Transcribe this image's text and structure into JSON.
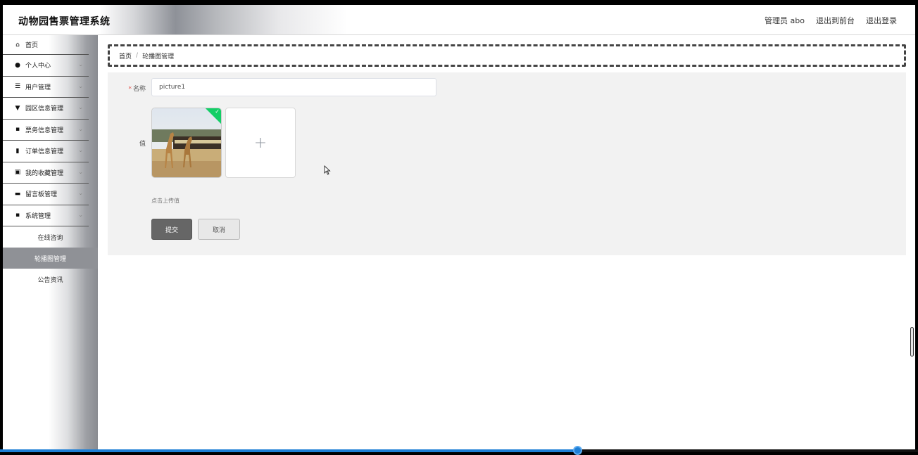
{
  "header": {
    "title": "动物园售票管理系统",
    "links": [
      "管理员 abo",
      "退出到前台",
      "退出登录"
    ]
  },
  "sidebar": {
    "items": [
      {
        "icon": "home-icon",
        "glyph": "⌂",
        "label": "首页",
        "has_children": false
      },
      {
        "icon": "user-icon",
        "glyph": "●",
        "label": "个人中心",
        "has_children": true
      },
      {
        "icon": "list-icon",
        "glyph": "☰",
        "label": "用户管理",
        "has_children": true
      },
      {
        "icon": "flag-icon",
        "glyph": "▼",
        "label": "园区信息管理",
        "has_children": true
      },
      {
        "icon": "grid-icon",
        "glyph": "▪",
        "label": "票务信息管理",
        "has_children": true
      },
      {
        "icon": "bar-chart-icon",
        "glyph": "▮",
        "label": "订单信息管理",
        "has_children": true
      },
      {
        "icon": "clipboard-icon",
        "glyph": "▣",
        "label": "我的收藏管理",
        "has_children": true
      },
      {
        "icon": "monitor-icon",
        "glyph": "▬",
        "label": "留言板管理",
        "has_children": true
      },
      {
        "icon": "grid-icon",
        "glyph": "▪",
        "label": "系统管理",
        "has_children": true
      }
    ],
    "sub_items": [
      {
        "label": "在线咨询",
        "active": false
      },
      {
        "label": "轮播图管理",
        "active": true
      },
      {
        "label": "公告资讯",
        "active": false
      }
    ]
  },
  "breadcrumb": {
    "home": "首页",
    "separator": "/",
    "current": "轮播图管理"
  },
  "form": {
    "name_label": "名称",
    "required_mark": "*",
    "name_value": "picture1",
    "value_label": "值",
    "image_icon": "giraffe-photo",
    "upload_symbol": "+",
    "upload_hint": "点击上传值",
    "submit_label": "提交",
    "cancel_label": "取消"
  },
  "colors": {
    "accent": "#13ce66",
    "progress": "#1e7fd6",
    "active_menu": "#8f9196"
  },
  "progress": {
    "fraction": 0.629
  }
}
